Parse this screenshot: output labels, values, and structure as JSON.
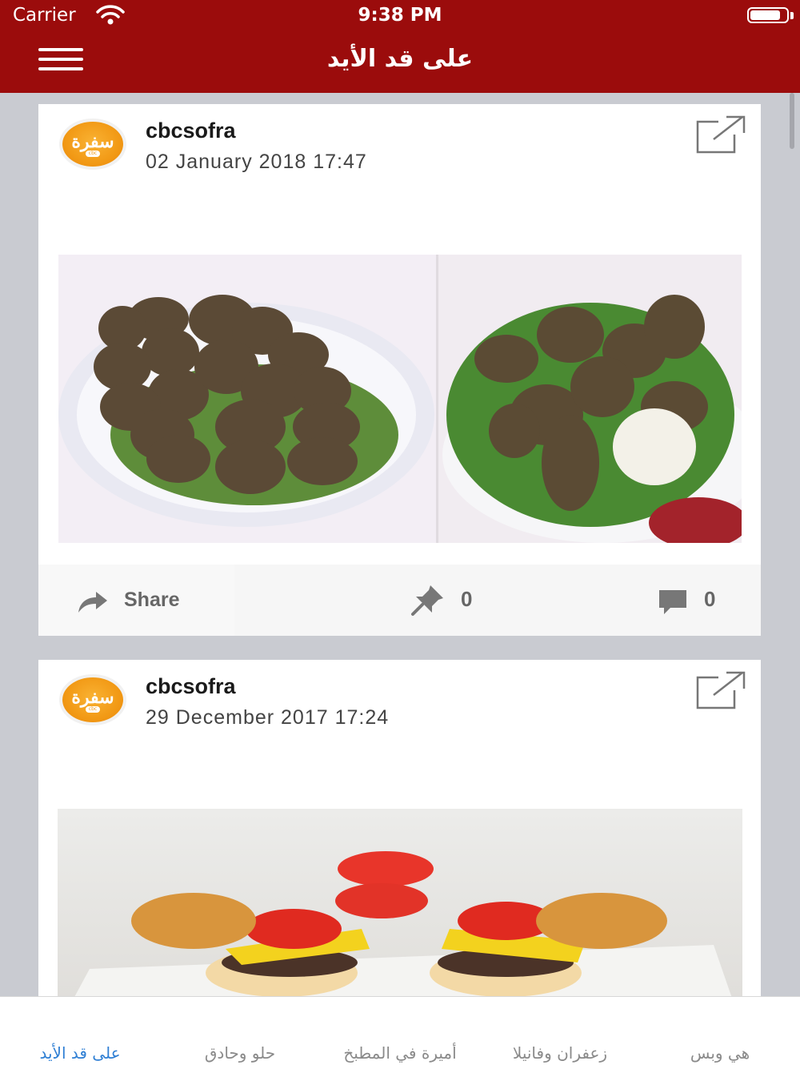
{
  "status_bar": {
    "carrier": "Carrier",
    "time": "9:38 PM",
    "battery_level": 0.85
  },
  "nav": {
    "title": "على قد الأيد",
    "menu_icon": "hamburger-menu-icon"
  },
  "posts": [
    {
      "avatar_text": "سفرة",
      "avatar_sub": "cbc",
      "username": "cbcsofra",
      "date": "02 January 2018 17:47",
      "share_label": "Share",
      "pin_count": "0",
      "comment_count": "0"
    },
    {
      "avatar_text": "سفرة",
      "avatar_sub": "cbc",
      "username": "cbcsofra",
      "date": "29 December 2017 17:24"
    }
  ],
  "tabs": [
    {
      "label": "هي وبس",
      "active": false
    },
    {
      "label": "زعفران وفانيلا",
      "active": false
    },
    {
      "label": "أميرة في المطبخ",
      "active": false
    },
    {
      "label": "حلو وحادق",
      "active": false
    },
    {
      "label": "على قد الأيد",
      "active": true
    }
  ],
  "colors": {
    "brand": "#9b0c0c",
    "tab_active": "#2f7fd4",
    "tab_inactive": "#8a8a8a",
    "logo_orange": "#f29a16"
  }
}
